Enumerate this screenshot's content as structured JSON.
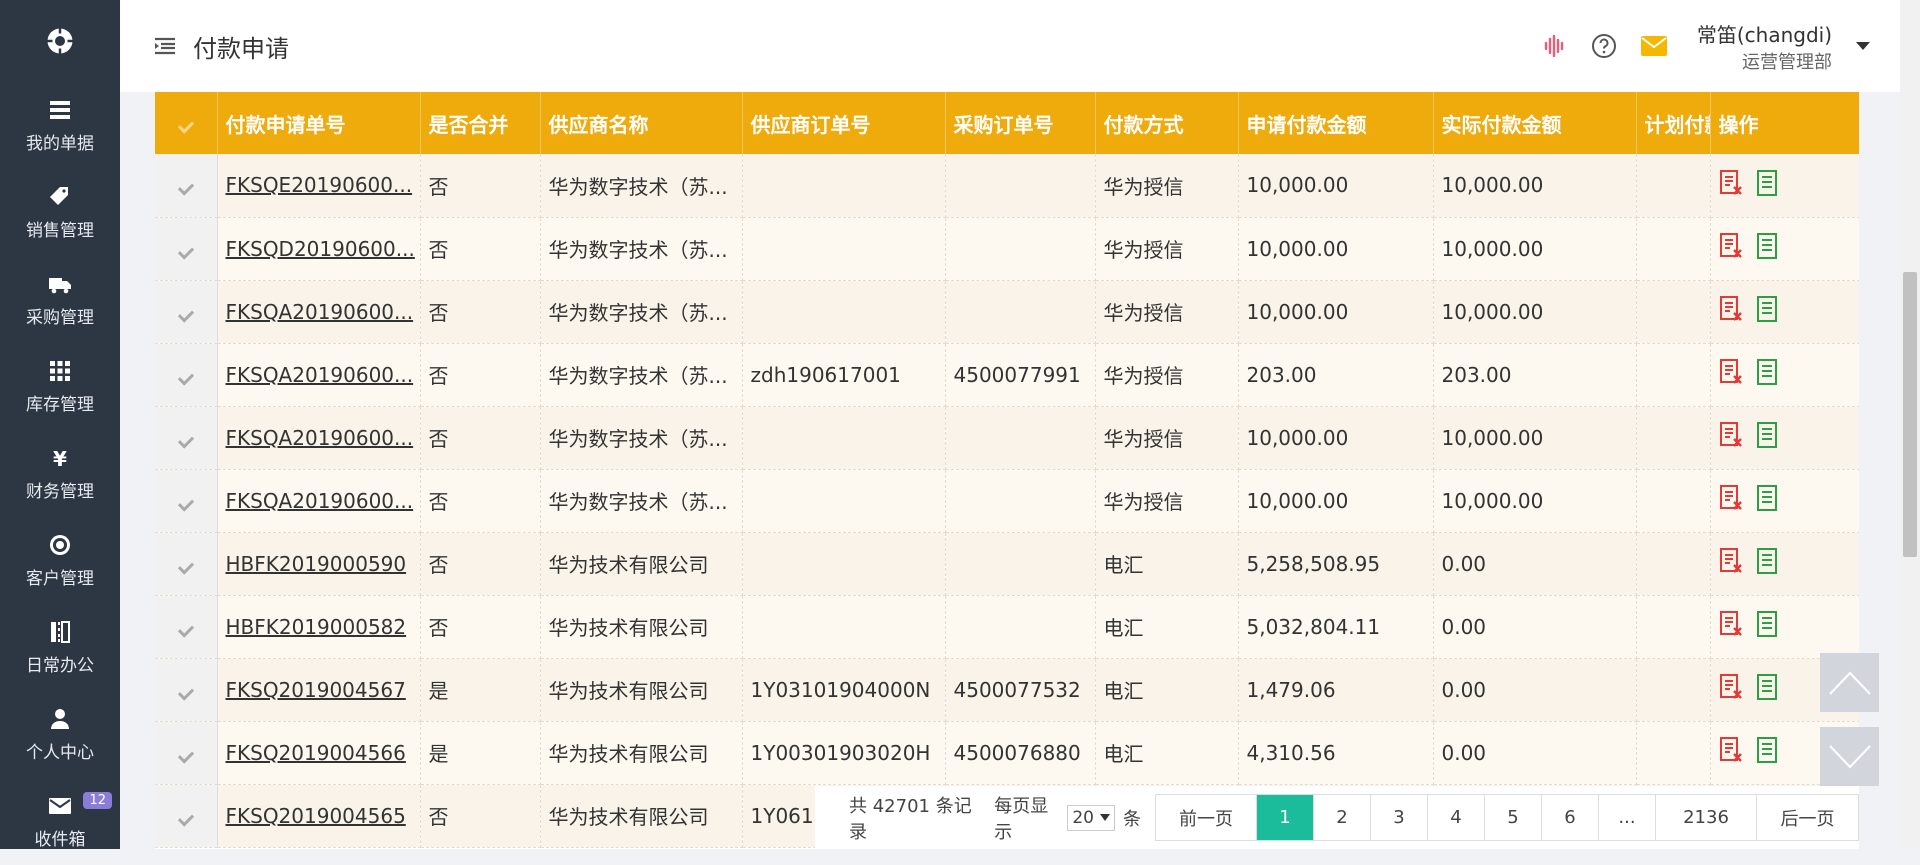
{
  "sidebar": {
    "logo_icon": "gear-logo-icon",
    "items": [
      {
        "label": "我的单据",
        "icon": "list-icon"
      },
      {
        "label": "销售管理",
        "icon": "tag-icon"
      },
      {
        "label": "采购管理",
        "icon": "truck-icon"
      },
      {
        "label": "库存管理",
        "icon": "grid-icon"
      },
      {
        "label": "财务管理",
        "icon": "yen-icon"
      },
      {
        "label": "客户管理",
        "icon": "target-icon"
      },
      {
        "label": "日常办公",
        "icon": "office-icon"
      },
      {
        "label": "个人中心",
        "icon": "user-icon"
      },
      {
        "label": "收件箱",
        "icon": "mail-icon",
        "badge": "12"
      }
    ]
  },
  "header": {
    "title": "付款申请",
    "user_name": "常笛(changdi)",
    "user_dept": "运营管理部",
    "icons": [
      "voice-icon",
      "help-icon",
      "message-icon"
    ]
  },
  "table": {
    "columns": [
      "付款申请单号",
      "是否合并",
      "供应商名称",
      "供应商订单号",
      "采购订单号",
      "付款方式",
      "申请付款金额",
      "实际付款金额",
      "计划付款",
      "操作"
    ],
    "rows": [
      {
        "no": "FKSQE20190600...",
        "merged": "否",
        "supplier": "华为数字技术（苏...",
        "supplier_order": "",
        "po": "",
        "method": "华为授信",
        "apply": "10,000.00",
        "actual": "10,000.00"
      },
      {
        "no": "FKSQD20190600...",
        "merged": "否",
        "supplier": "华为数字技术（苏...",
        "supplier_order": "",
        "po": "",
        "method": "华为授信",
        "apply": "10,000.00",
        "actual": "10,000.00"
      },
      {
        "no": "FKSQA20190600...",
        "merged": "否",
        "supplier": "华为数字技术（苏...",
        "supplier_order": "",
        "po": "",
        "method": "华为授信",
        "apply": "10,000.00",
        "actual": "10,000.00"
      },
      {
        "no": "FKSQA20190600...",
        "merged": "否",
        "supplier": "华为数字技术（苏...",
        "supplier_order": "zdh190617001",
        "po": "4500077991",
        "method": "华为授信",
        "apply": "203.00",
        "actual": "203.00"
      },
      {
        "no": "FKSQA20190600...",
        "merged": "否",
        "supplier": "华为数字技术（苏...",
        "supplier_order": "",
        "po": "",
        "method": "华为授信",
        "apply": "10,000.00",
        "actual": "10,000.00"
      },
      {
        "no": "FKSQA20190600...",
        "merged": "否",
        "supplier": "华为数字技术（苏...",
        "supplier_order": "",
        "po": "",
        "method": "华为授信",
        "apply": "10,000.00",
        "actual": "10,000.00"
      },
      {
        "no": "HBFK2019000590",
        "merged": "否",
        "supplier": "华为技术有限公司",
        "supplier_order": "",
        "po": "",
        "method": "电汇",
        "apply": "5,258,508.95",
        "actual": "0.00"
      },
      {
        "no": "HBFK2019000582",
        "merged": "否",
        "supplier": "华为技术有限公司",
        "supplier_order": "",
        "po": "",
        "method": "电汇",
        "apply": "5,032,804.11",
        "actual": "0.00"
      },
      {
        "no": "FKSQ2019004567",
        "merged": "是",
        "supplier": "华为技术有限公司",
        "supplier_order": "1Y03101904000N",
        "po": "4500077532",
        "method": "电汇",
        "apply": "1,479.06",
        "actual": "0.00"
      },
      {
        "no": "FKSQ2019004566",
        "merged": "是",
        "supplier": "华为技术有限公司",
        "supplier_order": "1Y00301903020H",
        "po": "4500076880",
        "method": "电汇",
        "apply": "4,310.56",
        "actual": "0.00"
      },
      {
        "no": "FKSQ2019004565",
        "merged": "否",
        "supplier": "华为技术有限公司",
        "supplier_order": "1Y061",
        "po": "",
        "method": "",
        "apply": "",
        "actual": ""
      }
    ]
  },
  "pager": {
    "total_text": "共 42701 条记录",
    "per_page_label": "每页显示",
    "per_page_value": "20",
    "unit": "条",
    "prev": "前一页",
    "pages": [
      "1",
      "2",
      "3",
      "4",
      "5",
      "6",
      "...",
      "2136"
    ],
    "current": "1",
    "next": "后一页"
  },
  "colors": {
    "sidebar": "#2d3744",
    "header_row": "#efaa0c",
    "active_page": "#1abc9c"
  }
}
